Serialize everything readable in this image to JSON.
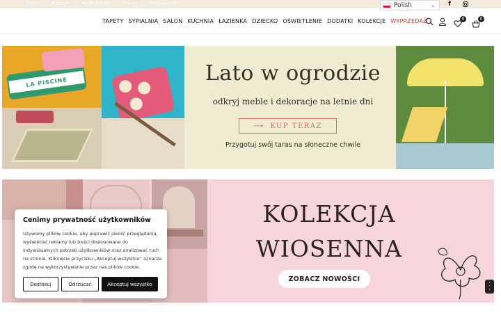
{
  "topbar": {
    "links": [
      "Start",
      "Koszyk",
      "Moje konto",
      "O nas",
      "Regulamin"
    ],
    "language": "Polish"
  },
  "nav": {
    "items": [
      "TAPETY",
      "SYPIALNIA",
      "SALON",
      "KUCHNIA",
      "ŁAZIENKA",
      "DZIECKO",
      "OŚWIETLENIE",
      "DODATKI",
      "KOLEKCJE",
      "WYPRZEDAŻ"
    ],
    "wishlist_count": "0",
    "cart_count": "0"
  },
  "banner1": {
    "title": "Lato w ogrodzie",
    "subtitle": "odkryj meble i dekoracje na letnie dni",
    "cta": "KUP TERAZ",
    "footer": "Przygotuj swój taras na słoneczne chwile",
    "cushion_text": "LA PISCINE"
  },
  "banner2": {
    "title_line1": "KOLEKCJA",
    "title_line2": "WIOSENNA",
    "cta": "ZOBACZ NOWOŚCI"
  },
  "cookie": {
    "title": "Cenimy prywatność użytkowników",
    "text": "Używamy plików cookie, aby poprawić jakość przeglądania, wyświetlać reklamy lub treści dostosowane do indywidualnych potrzeb użytkowników oraz analizować ruch na stronie. Kliknięcie przycisku „Akceptuj wszystkie” oznacza zgodę na wykorzystywanie przez nas plików cookie.",
    "customize": "Dostosuj",
    "reject": "Odrzucać",
    "accept": "Akceptuj wszystko"
  },
  "colors": {
    "topbar": "#f1eadd",
    "sale": "#c0322b",
    "banner1_bg": "#f0ecd2",
    "banner1_accent": "#c9705c",
    "banner2_bg": "#f6d6dc"
  }
}
